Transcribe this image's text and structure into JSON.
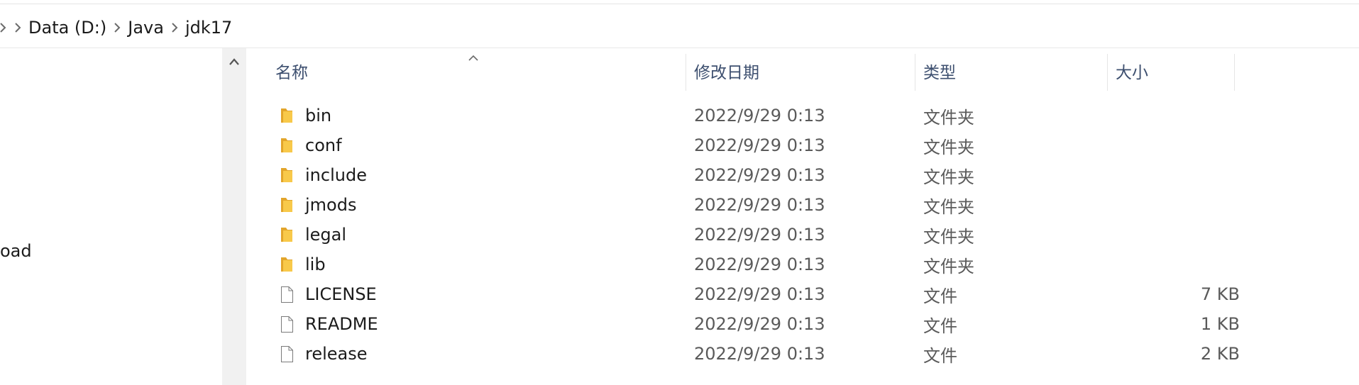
{
  "breadcrumb": {
    "parts": [
      "Data (D:)",
      "Java",
      "jdk17"
    ],
    "separator_icon": "chevron-right-icon"
  },
  "nav_pane": {
    "partial_item_label": "oad"
  },
  "columns": {
    "name": "名称",
    "modified": "修改日期",
    "type": "类型",
    "size": "大小",
    "sorted_by": "名称",
    "sort_direction": "ascending"
  },
  "files": [
    {
      "name": "bin",
      "modified": "2022/9/29 0:13",
      "type": "文件夹",
      "size": "",
      "icon": "folder-icon"
    },
    {
      "name": "conf",
      "modified": "2022/9/29 0:13",
      "type": "文件夹",
      "size": "",
      "icon": "folder-icon"
    },
    {
      "name": "include",
      "modified": "2022/9/29 0:13",
      "type": "文件夹",
      "size": "",
      "icon": "folder-icon"
    },
    {
      "name": "jmods",
      "modified": "2022/9/29 0:13",
      "type": "文件夹",
      "size": "",
      "icon": "folder-icon"
    },
    {
      "name": "legal",
      "modified": "2022/9/29 0:13",
      "type": "文件夹",
      "size": "",
      "icon": "folder-icon"
    },
    {
      "name": "lib",
      "modified": "2022/9/29 0:13",
      "type": "文件夹",
      "size": "",
      "icon": "folder-icon"
    },
    {
      "name": "LICENSE",
      "modified": "2022/9/29 0:13",
      "type": "文件",
      "size": "7 KB",
      "icon": "file-icon"
    },
    {
      "name": "README",
      "modified": "2022/9/29 0:13",
      "type": "文件",
      "size": "1 KB",
      "icon": "file-icon"
    },
    {
      "name": "release",
      "modified": "2022/9/29 0:13",
      "type": "文件",
      "size": "2 KB",
      "icon": "file-icon"
    }
  ],
  "colors": {
    "folder_yellow": "#f8c94a",
    "folder_dark": "#e2a52b",
    "header_text": "#3d4f6f",
    "scroll_track": "#f1f1f1"
  }
}
